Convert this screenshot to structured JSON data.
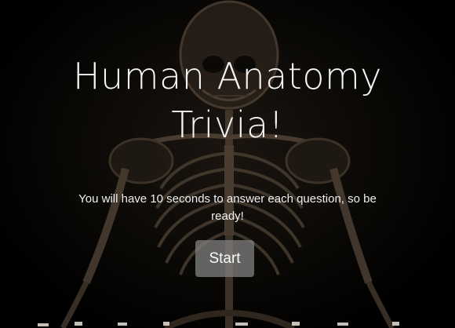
{
  "page": {
    "title": "Human Anatomy Trivia!",
    "subtitle": "You will have 10 seconds to answer each question, so be ready!",
    "start_label": "Start"
  },
  "background": {
    "image": "human-skeleton",
    "base_color": "#000000"
  },
  "colors": {
    "text": "#f4f4f4",
    "button_bg": "#828282"
  }
}
